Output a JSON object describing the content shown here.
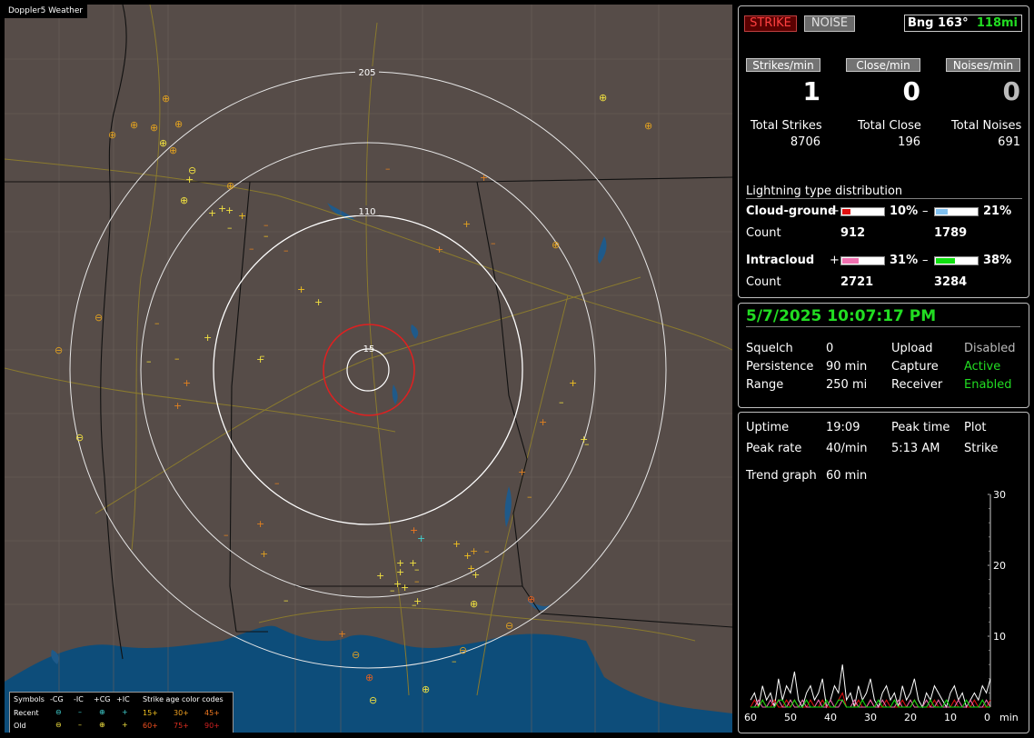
{
  "map": {
    "title": "Doppler5 Weather",
    "ring_labels": [
      "205",
      "110",
      "15"
    ]
  },
  "legend": {
    "symbols_label": "Symbols",
    "columns": [
      "-CG",
      "-IC",
      "+CG",
      "+IC"
    ],
    "age_label": "Strike age color codes",
    "recent_label": "Recent",
    "old_label": "Old",
    "recent_ages": [
      "15+",
      "30+",
      "45+"
    ],
    "old_ages": [
      "60+",
      "75+",
      "90+"
    ],
    "age_colors": [
      "#f0c020",
      "#f0a020",
      "#f07820",
      "#f05020",
      "#e03020",
      "#d02020"
    ]
  },
  "top": {
    "strike_label": "STRIKE",
    "noise_label": "NOISE",
    "bearing": "Bng 163°",
    "distance": "118mi"
  },
  "rates": {
    "strikes_label": "Strikes/min",
    "close_label": "Close/min",
    "noises_label": "Noises/min",
    "strikes": "1",
    "close": "0",
    "noises": "0"
  },
  "totals": {
    "strikes_label": "Total Strikes",
    "close_label": "Total Close",
    "noises_label": "Total Noises",
    "strikes": "8706",
    "close": "196",
    "noises": "691"
  },
  "distribution": {
    "title": "Lightning type distribution",
    "cg_label": "Cloud-ground",
    "ic_label": "Intracloud",
    "count_label": "Count",
    "plus": "+",
    "minus": "–",
    "cg_plus_pct": "10%",
    "cg_minus_pct": "21%",
    "ic_plus_pct": "31%",
    "ic_minus_pct": "38%",
    "cg_plus_count": "912",
    "cg_minus_count": "1789",
    "ic_plus_count": "2721",
    "ic_minus_count": "3284",
    "cg_plus_fill": 0.1,
    "cg_minus_fill": 0.21,
    "ic_plus_fill": 0.31,
    "ic_minus_fill": 0.38,
    "colors": {
      "cg_plus": "#e01010",
      "cg_minus": "#80c0f0",
      "ic_plus": "#f070b0",
      "ic_minus": "#10e010"
    }
  },
  "status": {
    "datetime": "5/7/2025 10:07:17 PM",
    "squelch_label": "Squelch",
    "squelch": "0",
    "persistence_label": "Persistence",
    "persistence": "90 min",
    "range_label": "Range",
    "range": "250 mi",
    "upload_label": "Upload",
    "upload": "Disabled",
    "capture_label": "Capture",
    "capture": "Active",
    "receiver_label": "Receiver",
    "receiver": "Enabled"
  },
  "stats": {
    "uptime_label": "Uptime",
    "uptime": "19:09",
    "peak_time_label": "Peak time",
    "peak_time": "5:13 AM",
    "plot_label": "Plot",
    "plot": "Strike",
    "peak_rate_label": "Peak rate",
    "peak_rate": "40/min",
    "trend_label": "Trend graph",
    "trend": "60 min"
  },
  "chart_data": {
    "type": "line",
    "x_tick_labels": [
      "60",
      "50",
      "40",
      "30",
      "20",
      "10",
      "0"
    ],
    "x_unit": "min",
    "y_tick_labels": [
      "30",
      "20",
      "10"
    ],
    "ylim": [
      0,
      30
    ],
    "xlim": [
      60,
      0
    ],
    "series": [
      {
        "color": "#ffffff",
        "values": [
          1,
          2,
          0,
          3,
          1,
          2,
          0,
          4,
          1,
          3,
          2,
          5,
          1,
          0,
          2,
          3,
          1,
          2,
          4,
          0,
          1,
          3,
          2,
          6,
          1,
          2,
          0,
          3,
          1,
          2,
          4,
          1,
          0,
          2,
          3,
          1,
          2,
          0,
          3,
          1,
          2,
          4,
          1,
          0,
          2,
          1,
          3,
          2,
          1,
          0,
          2,
          3,
          1,
          2,
          0,
          1,
          2,
          1,
          3,
          2,
          4
        ]
      },
      {
        "color": "#e01010",
        "values": [
          0,
          1,
          0,
          1,
          0,
          0,
          1,
          0,
          0,
          1,
          0,
          1,
          0,
          0,
          0,
          1,
          0,
          0,
          1,
          0,
          0,
          0,
          1,
          2,
          0,
          0,
          0,
          1,
          0,
          0,
          1,
          0,
          0,
          0,
          1,
          0,
          0,
          0,
          1,
          0,
          0,
          1,
          0,
          0,
          0,
          0,
          1,
          0,
          0,
          0,
          0,
          1,
          0,
          0,
          0,
          0,
          1,
          0,
          0,
          0,
          1
        ]
      },
      {
        "color": "#f070b0",
        "values": [
          0,
          0,
          1,
          0,
          0,
          1,
          0,
          1,
          0,
          0,
          1,
          0,
          0,
          1,
          0,
          0,
          0,
          1,
          0,
          0,
          1,
          0,
          0,
          1,
          0,
          0,
          1,
          0,
          0,
          0,
          1,
          0,
          0,
          1,
          0,
          0,
          0,
          1,
          0,
          0,
          1,
          0,
          0,
          0,
          1,
          0,
          0,
          1,
          0,
          0,
          0,
          0,
          1,
          0,
          0,
          1,
          0,
          0,
          0,
          1,
          0
        ]
      },
      {
        "color": "#10e010",
        "values": [
          0,
          0,
          0,
          1,
          0,
          0,
          0,
          1,
          1,
          0,
          0,
          1,
          0,
          0,
          1,
          0,
          0,
          0,
          0,
          1,
          0,
          0,
          1,
          1,
          0,
          0,
          0,
          0,
          1,
          0,
          0,
          0,
          1,
          0,
          0,
          0,
          1,
          0,
          0,
          0,
          0,
          1,
          0,
          0,
          0,
          1,
          0,
          0,
          0,
          1,
          0,
          0,
          0,
          0,
          1,
          0,
          0,
          0,
          1,
          0,
          0
        ]
      }
    ]
  }
}
